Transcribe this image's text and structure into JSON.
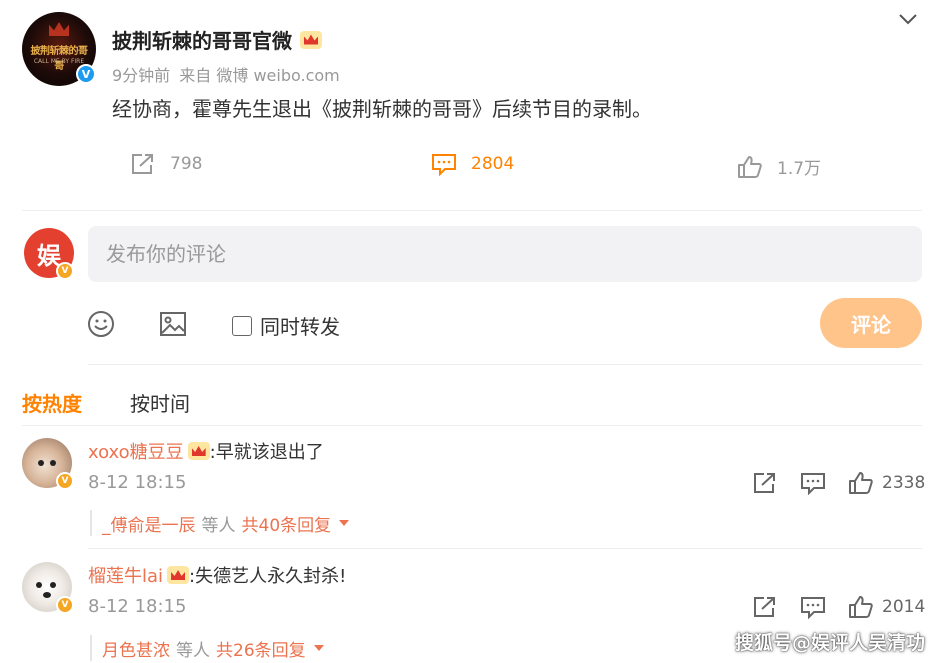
{
  "post": {
    "author": "披荆斩棘的哥哥官微",
    "time": "9分钟前",
    "source": "来自 微博 weibo.com",
    "text": "经协商，霍尊先生退出《披荆斩棘的哥哥》后续节目的录制。",
    "repost_count": "798",
    "comment_count": "2804",
    "like_count": "1.7万",
    "avatar_text": "披荆斩棘的哥哥",
    "avatar_subtext": "CALL ME BY FIRE"
  },
  "composer": {
    "avatar_glyph": "娱",
    "placeholder": "发布你的评论",
    "sync_label": "同时转发",
    "submit_label": "评论"
  },
  "sort": {
    "hot_label": "按热度",
    "time_label": "按时间"
  },
  "comments": [
    {
      "user": "xoxo糖豆豆",
      "text": ":早就该退出了",
      "time": "8-12 18:15",
      "likes": "2338",
      "reply_by": "_傅俞是一辰",
      "reply_mid": "等人",
      "reply_count": "共40条回复"
    },
    {
      "user": "榴莲牛lai",
      "text": ":失德艺人永久封杀!",
      "time": "8-12 18:15",
      "likes": "2014",
      "reply_by": "月色甚浓",
      "reply_mid": "等人",
      "reply_count": "共26条回复"
    }
  ],
  "watermark": "搜狐号@娱评人吴清功",
  "colors": {
    "accent": "#ff8200",
    "username": "#eb7350",
    "submit": "#ffc48a",
    "verified_blue": "#1d9bf0",
    "verified_gold": "#f5a623"
  }
}
